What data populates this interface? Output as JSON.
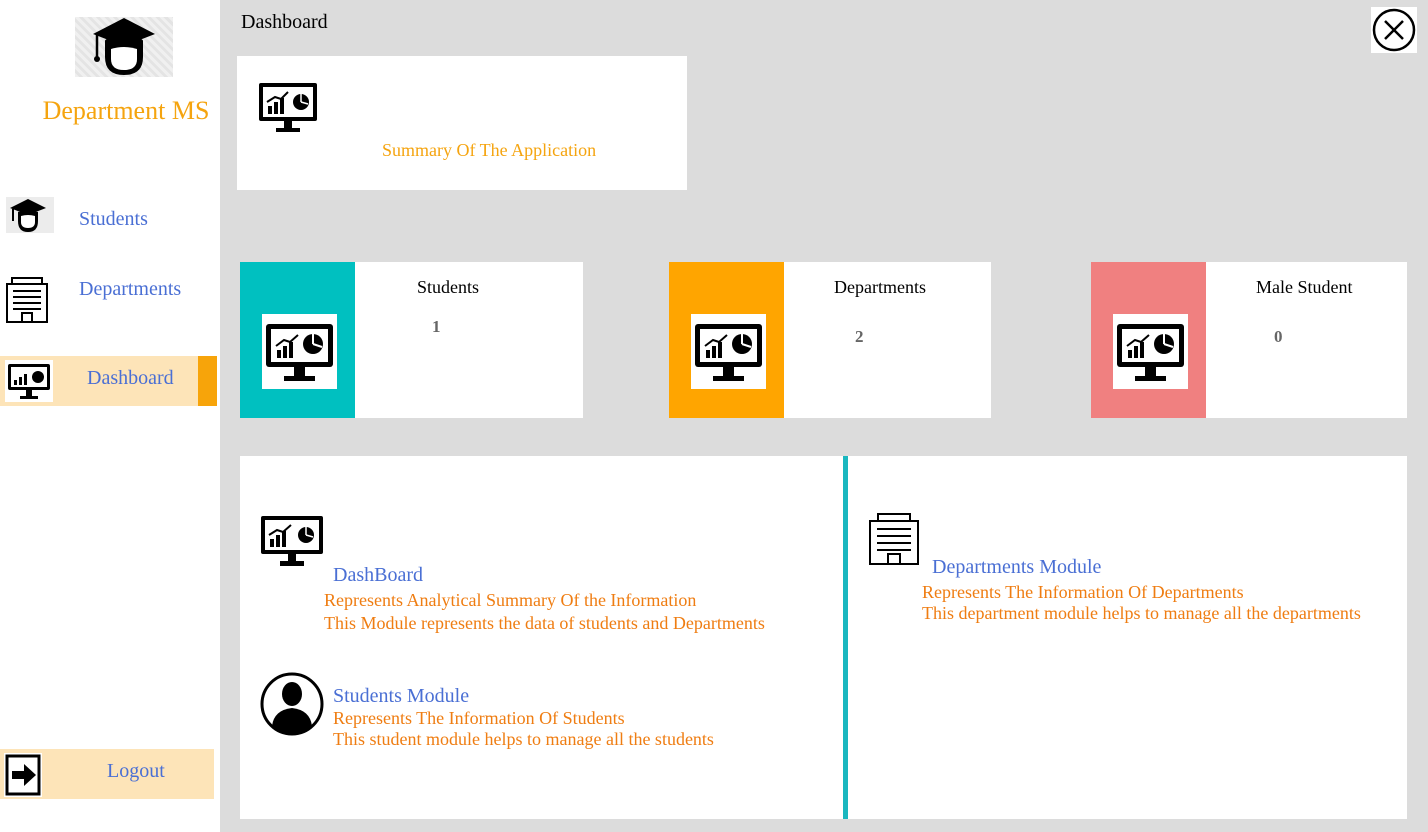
{
  "app": {
    "name": "Department MS",
    "page_title": "Dashboard"
  },
  "sidebar": {
    "items": [
      {
        "label": "Students",
        "icon": "graduate-icon"
      },
      {
        "label": "Departments",
        "icon": "building-icon"
      },
      {
        "label": "Dashboard",
        "icon": "dashboard-monitor-icon",
        "active": true
      }
    ],
    "logout_label": "Logout"
  },
  "summary": {
    "text": "Summary Of The Application"
  },
  "stats": [
    {
      "label": "Students",
      "value": "1",
      "color": "#00c0c0"
    },
    {
      "label": "Departments",
      "value": "2",
      "color": "#ffa500"
    },
    {
      "label": "Male Student",
      "value": "0",
      "color": "#f08080"
    }
  ],
  "modules": {
    "dashboard": {
      "title": "DashBoard",
      "line1": "Represents Analytical Summary Of the Information",
      "line2": "This Module represents the data of students and Departments"
    },
    "students": {
      "title": "Students Module",
      "line1": "Represents The Information Of Students",
      "line2": "This student module helps to manage all the students"
    },
    "departments": {
      "title": "Departments Module",
      "line1": "Represents The Information Of Departments",
      "line2": "This department module helps to manage all the departments"
    }
  },
  "colors": {
    "accent_orange": "#f7a40a",
    "link_blue": "#4a6fd4",
    "text_orange": "#ef7d12",
    "divider_teal": "#1ab7bf"
  }
}
